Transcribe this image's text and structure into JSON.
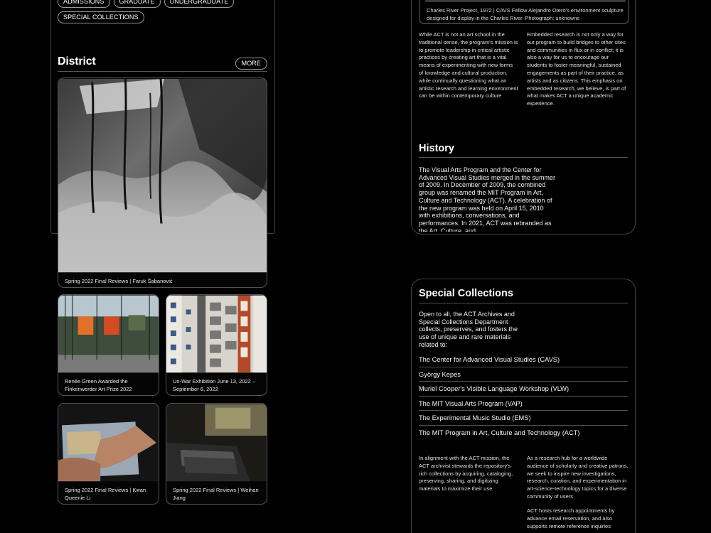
{
  "program_tags": [
    [
      "ADMISSIONS",
      "GRADUATE",
      "UNDERGRADUATE"
    ],
    [
      "SPECIAL COLLECTIONS"
    ]
  ],
  "district": {
    "title": "District",
    "more_label": "MORE",
    "feature_caption": "Spring 2022 Final Reviews | Faruk Šabanović",
    "cards": [
      {
        "caption": "Renée Green Awarded the Finkenwerder Art Prize 2022"
      },
      {
        "caption": "Un-War Exhibition June 13, 2022 – September 6, 2022"
      },
      {
        "caption": "Spring 2022 Final Reviews | Kwan Queenie Li"
      },
      {
        "caption": "Spring 2022 Final Reviews | Weihan Jiang"
      }
    ]
  },
  "about": {
    "image_caption": "Charles River Project, 1972 | CAVS Fellow Alejandro Otero's environment sculpture designed for display in the Charles River. Photograph: unknowns",
    "col1": "While ACT is not an art school in the traditional sense, the program's mission is to promote leadership in critical artistic practices by creating art that is a vital means of experimenting with new forms of knowledge and cultural production, while continually questioning what an artistic research and learning environment can be within contemporary culture",
    "col2": "Embedded research is not only a way for our program to build bridges to other sites and communities in flux or in conflict; it is also a way for us to encourage our students to foster meaningful, sustained engagements as part of their practice, as artists and as citizens. This emphasis on embedded research, we believe, is part of what makes ACT a unique academic experience."
  },
  "history": {
    "title": "History",
    "text": "The Visual Arts Program and the Center for Advanced Visual Studies merged in the summer of 2009. In December of 2009, the combined group was renamed the MIT Program in Art, Culture and Technology (ACT). A celebration of the new program was held on April 15, 2010 with exhibitions, conversations, and performances. In 2021, ACT was rebranded as the Art, Culture, and"
  },
  "special_collections": {
    "title": "Special Collections",
    "intro": "Open to all, the ACT Archives and Special Collections Department collects, preserves, and fosters the use of unique and rare materials related to:",
    "items": [
      "The Center for Advanced Visual Studies (CAVS)",
      "György Kepes",
      "Muriel Cooper's Visible Language Workshop (VLW)",
      "The MIT Visual Arts Program (VAP)",
      "The Experimental Music Studio (EMS)",
      "The MIT Program in Art, Culture and Technology (ACT)"
    ],
    "col1": "In alignment with the ACT mission, the ACT archivist stewards the repository's rich collections by acquiring, cataloging, preserving, sharing, and digitizing materials to maximize their use",
    "col2a": "As a research hub for a worldwide audience of scholarly and creative patrons, we seek to inspire new investigations, research, curation, and experimentation in art-science-technology topics for a diverse community of users",
    "col2b": "ACT hosts research appointments by advance email reservation, and also supports remote reference inquiries"
  }
}
